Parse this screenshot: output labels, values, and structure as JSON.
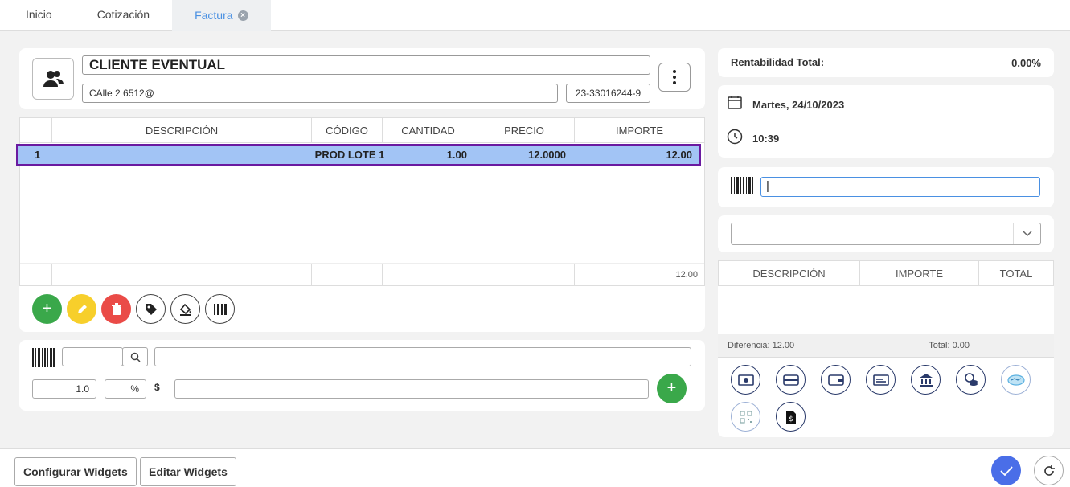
{
  "tabs": [
    {
      "label": "Inicio"
    },
    {
      "label": "Cotización"
    },
    {
      "label": "Factura"
    }
  ],
  "client": {
    "name": "CLIENTE EVENTUAL",
    "address": "CAlle 2 6512@",
    "cuit": "23-33016244-9"
  },
  "items": {
    "headers": {
      "desc": "DESCRIPCIÓN",
      "code": "CÓDIGO",
      "qty": "CANTIDAD",
      "price": "PRECIO",
      "amount": "IMPORTE"
    },
    "rows": [
      {
        "num": "1",
        "desc": "",
        "code": "PROD LOTE 1",
        "qty": "1.00",
        "price": "12.0000",
        "amount": "12.00"
      }
    ],
    "total": "12.00"
  },
  "quick": {
    "qty": "1.0",
    "pct": "%",
    "currency": "$"
  },
  "right": {
    "rentabilidad_label": "Rentabilidad Total:",
    "rentabilidad_value": "0.00%",
    "date": "Martes, 24/10/2023",
    "time": "10:39"
  },
  "payments": {
    "headers": {
      "desc": "DESCRIPCIÓN",
      "amount": "IMPORTE",
      "total": "TOTAL"
    },
    "diferencia": "Diferencia: 12.00",
    "total": "Total: 0.00"
  },
  "bottom": {
    "config_label": "Configurar Widgets",
    "edit_label": "Editar Widgets"
  },
  "colors": {
    "accent": "#4a90e2",
    "selected_row": "#a2c4f5",
    "selected_border": "#6a1aa0",
    "green": "#3aa84a",
    "yellow": "#f7cf2b",
    "red": "#ea4b47",
    "confirm": "#4a6ee8"
  }
}
